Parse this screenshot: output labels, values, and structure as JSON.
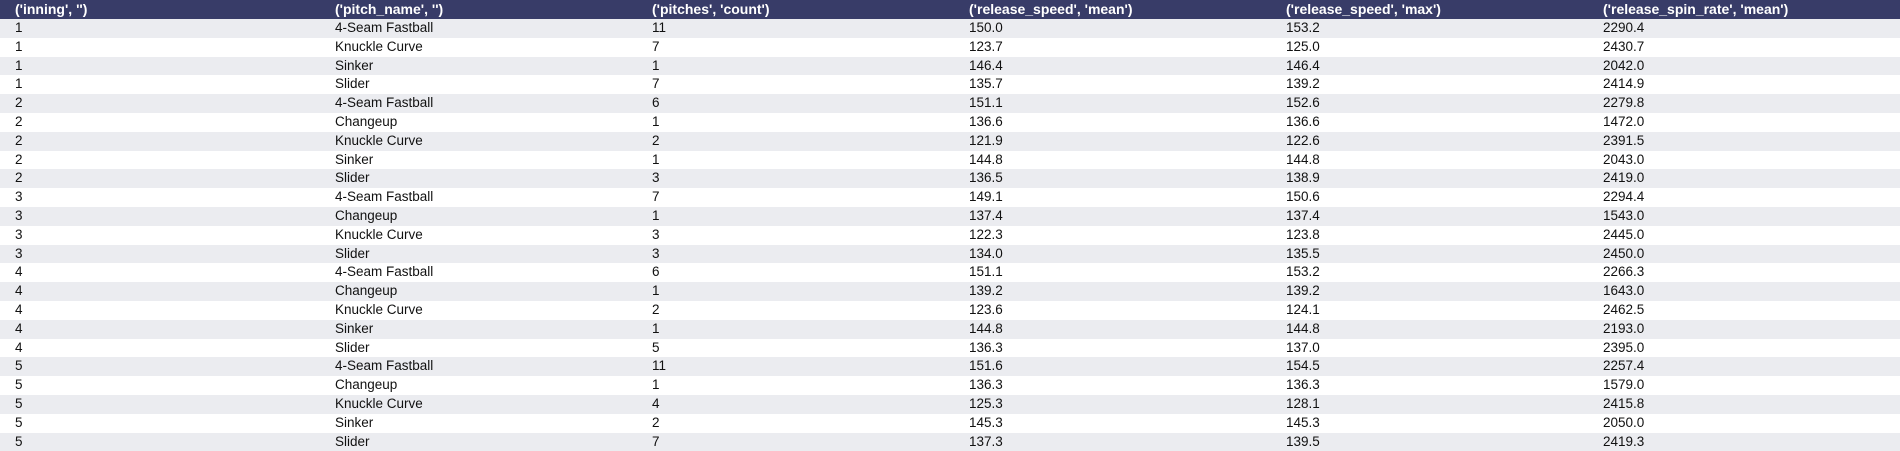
{
  "table": {
    "columns": [
      "('inning', '')",
      "('pitch_name', '')",
      "('pitches', 'count')",
      "('release_speed', 'mean')",
      "('release_speed', 'max')",
      "('release_spin_rate', 'mean')"
    ],
    "rows": [
      [
        "1",
        "4-Seam Fastball",
        "11",
        "150.0",
        "153.2",
        "2290.4"
      ],
      [
        "1",
        "Knuckle Curve",
        "7",
        "123.7",
        "125.0",
        "2430.7"
      ],
      [
        "1",
        "Sinker",
        "1",
        "146.4",
        "146.4",
        "2042.0"
      ],
      [
        "1",
        "Slider",
        "7",
        "135.7",
        "139.2",
        "2414.9"
      ],
      [
        "2",
        "4-Seam Fastball",
        "6",
        "151.1",
        "152.6",
        "2279.8"
      ],
      [
        "2",
        "Changeup",
        "1",
        "136.6",
        "136.6",
        "1472.0"
      ],
      [
        "2",
        "Knuckle Curve",
        "2",
        "121.9",
        "122.6",
        "2391.5"
      ],
      [
        "2",
        "Sinker",
        "1",
        "144.8",
        "144.8",
        "2043.0"
      ],
      [
        "2",
        "Slider",
        "3",
        "136.5",
        "138.9",
        "2419.0"
      ],
      [
        "3",
        "4-Seam Fastball",
        "7",
        "149.1",
        "150.6",
        "2294.4"
      ],
      [
        "3",
        "Changeup",
        "1",
        "137.4",
        "137.4",
        "1543.0"
      ],
      [
        "3",
        "Knuckle Curve",
        "3",
        "122.3",
        "123.8",
        "2445.0"
      ],
      [
        "3",
        "Slider",
        "3",
        "134.0",
        "135.5",
        "2450.0"
      ],
      [
        "4",
        "4-Seam Fastball",
        "6",
        "151.1",
        "153.2",
        "2266.3"
      ],
      [
        "4",
        "Changeup",
        "1",
        "139.2",
        "139.2",
        "1643.0"
      ],
      [
        "4",
        "Knuckle Curve",
        "2",
        "123.6",
        "124.1",
        "2462.5"
      ],
      [
        "4",
        "Sinker",
        "1",
        "144.8",
        "144.8",
        "2193.0"
      ],
      [
        "4",
        "Slider",
        "5",
        "136.3",
        "137.0",
        "2395.0"
      ],
      [
        "5",
        "4-Seam Fastball",
        "11",
        "151.6",
        "154.5",
        "2257.4"
      ],
      [
        "5",
        "Changeup",
        "1",
        "136.3",
        "136.3",
        "1579.0"
      ],
      [
        "5",
        "Knuckle Curve",
        "4",
        "125.3",
        "128.1",
        "2415.8"
      ],
      [
        "5",
        "Sinker",
        "2",
        "145.3",
        "145.3",
        "2050.0"
      ],
      [
        "5",
        "Slider",
        "7",
        "137.3",
        "139.5",
        "2419.3"
      ]
    ]
  },
  "colors": {
    "header_bg": "#383c68",
    "header_text": "#ffffff",
    "row_stripe": "#ebecf0",
    "row_plain": "#ffffff"
  }
}
